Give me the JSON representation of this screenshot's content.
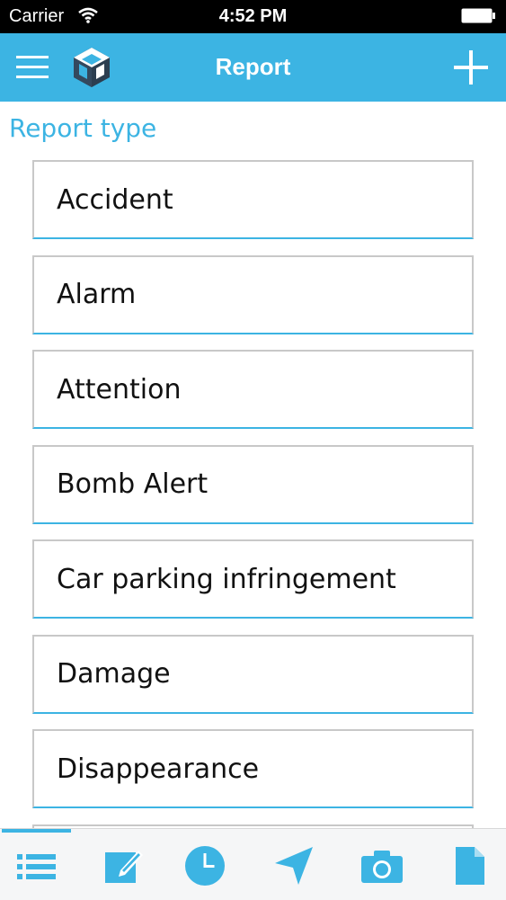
{
  "status_bar": {
    "carrier": "Carrier",
    "time": "4:52 PM"
  },
  "nav": {
    "title": "Report",
    "icons": {
      "menu": "hamburger-menu-icon",
      "logo": "app-logo-cube-icon",
      "add": "plus-icon"
    }
  },
  "section_title": "Report type",
  "report_types": [
    "Accident",
    "Alarm",
    "Attention",
    "Bomb Alert",
    "Car parking infringement",
    "Damage",
    "Disappearance"
  ],
  "tab_bar": {
    "active_index": 0,
    "tabs": [
      "list-icon",
      "edit-icon",
      "clock-icon",
      "send-icon",
      "camera-icon",
      "document-icon"
    ]
  },
  "colors": {
    "accent": "#3cb4e3",
    "text": "#111111",
    "status_bar": "#000000"
  }
}
